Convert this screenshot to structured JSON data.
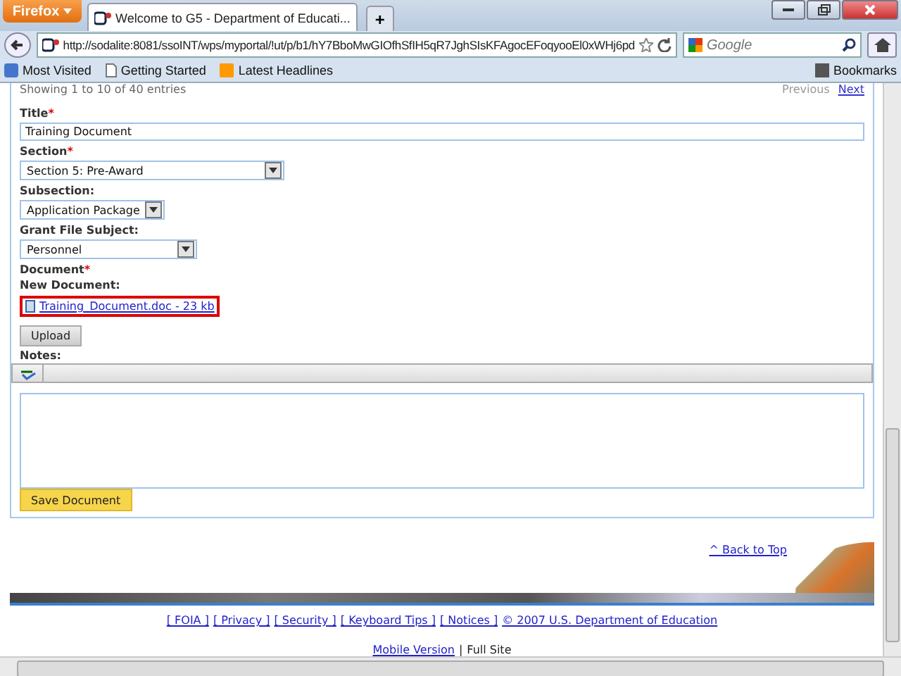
{
  "browser": {
    "menu_button": "Firefox",
    "tabs": [
      {
        "title": "Welcome to G5 - Department of Educati...",
        "selected": true
      }
    ],
    "new_tab": "+",
    "url": "http://sodalite:8081/ssoINT/wps/myportal/!ut/p/b1/hY7BboMwGIOfhSfIH5qR7JghSIsKFAgocEFoqyooEl0xWHj6pd",
    "search_placeholder": "Google",
    "bookmarks": [
      "Most Visited",
      "Getting Started",
      "Latest Headlines"
    ],
    "bookmarks_menu": "Bookmarks"
  },
  "pager": {
    "summary": "Showing 1 to 10 of 40 entries",
    "previous": "Previous",
    "next": "Next"
  },
  "fields": [
    {
      "kind": "text",
      "label": "Title",
      "mark": "*",
      "value": "Training Document"
    },
    {
      "kind": "select",
      "label": "Section",
      "mark": "*",
      "value": "Section 5: Pre-Award"
    },
    {
      "kind": "select",
      "label": "Subsection:",
      "value": "Application Package"
    },
    {
      "kind": "select",
      "label": "Grant File Subject:",
      "value": "Personnel"
    }
  ],
  "document": {
    "label": "Document",
    "mark": "*",
    "new_label": "New Document:",
    "file_link": "Training_Document.doc - 23 kb",
    "highlighted": true
  },
  "upload_button": "Upload",
  "notes": {
    "label": "Notes:"
  },
  "save_button": "Save Document",
  "back_to_top": "^ Back to Top",
  "footer_links": [
    "[ FOIA ]",
    "[ Privacy ]",
    "[ Security ]",
    "[ Keyboard Tips ]",
    "[ Notices ]",
    "© 2007 U.S. Department of Education"
  ],
  "mobile_link": "Mobile Version",
  "separator": "|",
  "full_site": "Full Site"
}
